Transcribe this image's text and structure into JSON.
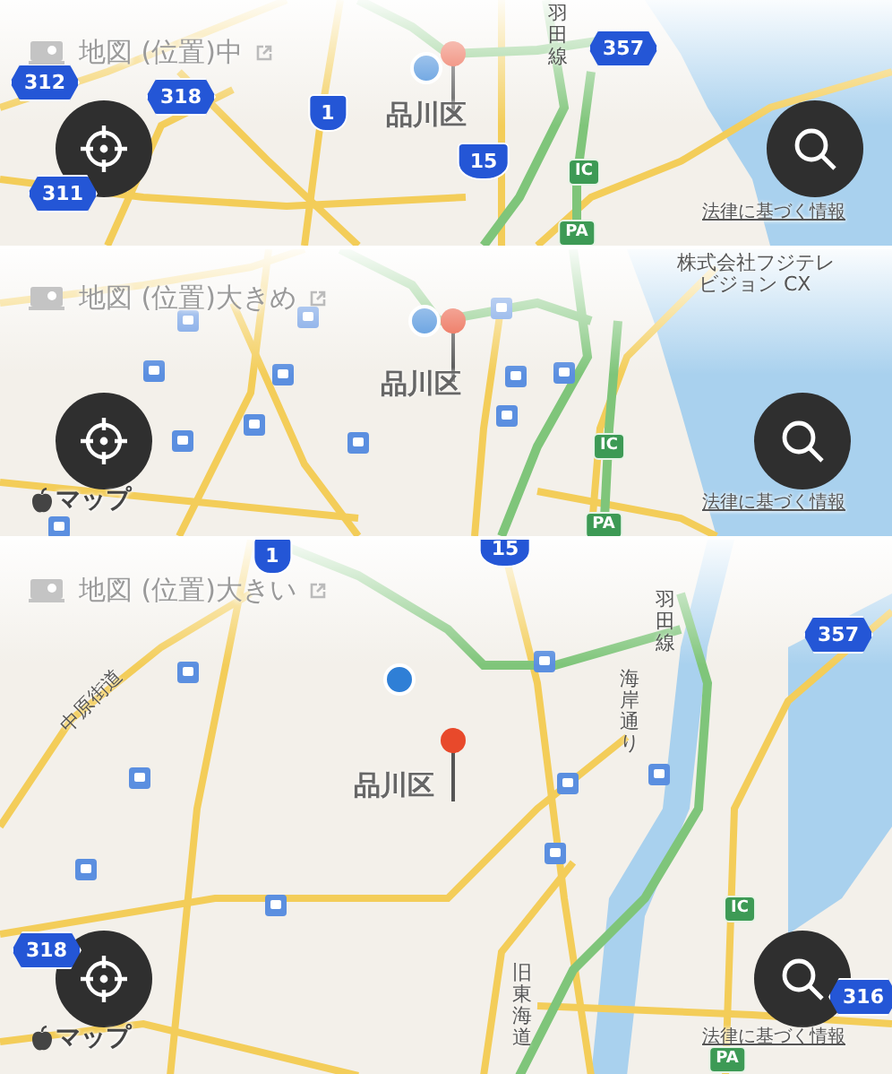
{
  "panels": [
    {
      "title": "地図 (位置)中",
      "district": "品川区",
      "shields": [
        {
          "text": "312",
          "kind": "route"
        },
        {
          "text": "318",
          "kind": "route"
        },
        {
          "text": "1",
          "kind": "national"
        },
        {
          "text": "15",
          "kind": "national"
        },
        {
          "text": "357",
          "kind": "route"
        },
        {
          "text": "IC",
          "kind": "expressway"
        },
        {
          "text": "PA",
          "kind": "expressway"
        },
        {
          "text": "311",
          "kind": "route"
        }
      ],
      "map_labels": [
        {
          "text": "羽田線",
          "kind": "vertical"
        }
      ],
      "legal_link": "法律に基づく情報"
    },
    {
      "title": "地図 (位置)大きめ",
      "district": "品川区",
      "shields": [
        {
          "text": "IC",
          "kind": "expressway"
        },
        {
          "text": "PA",
          "kind": "expressway"
        }
      ],
      "map_labels": [
        {
          "text": "株式会社フジテレ",
          "kind": "horizontal"
        },
        {
          "text": "ビジョン CX",
          "kind": "horizontal"
        }
      ],
      "brand": "マップ",
      "legal_link": "法律に基づく情報"
    },
    {
      "title": "地図 (位置)大きい",
      "district": "品川区",
      "shields": [
        {
          "text": "1",
          "kind": "national"
        },
        {
          "text": "15",
          "kind": "national"
        },
        {
          "text": "357",
          "kind": "route"
        },
        {
          "text": "318",
          "kind": "route"
        },
        {
          "text": "316",
          "kind": "route"
        },
        {
          "text": "IC",
          "kind": "expressway"
        },
        {
          "text": "PA",
          "kind": "expressway"
        }
      ],
      "map_labels": [
        {
          "text": "中原街道",
          "kind": "slanted"
        },
        {
          "text": "海岸通り",
          "kind": "vertical"
        },
        {
          "text": "羽田線",
          "kind": "vertical"
        },
        {
          "text": "旧東海道",
          "kind": "vertical"
        }
      ],
      "brand": "マップ",
      "legal_link": "法律に基づく情報"
    }
  ]
}
